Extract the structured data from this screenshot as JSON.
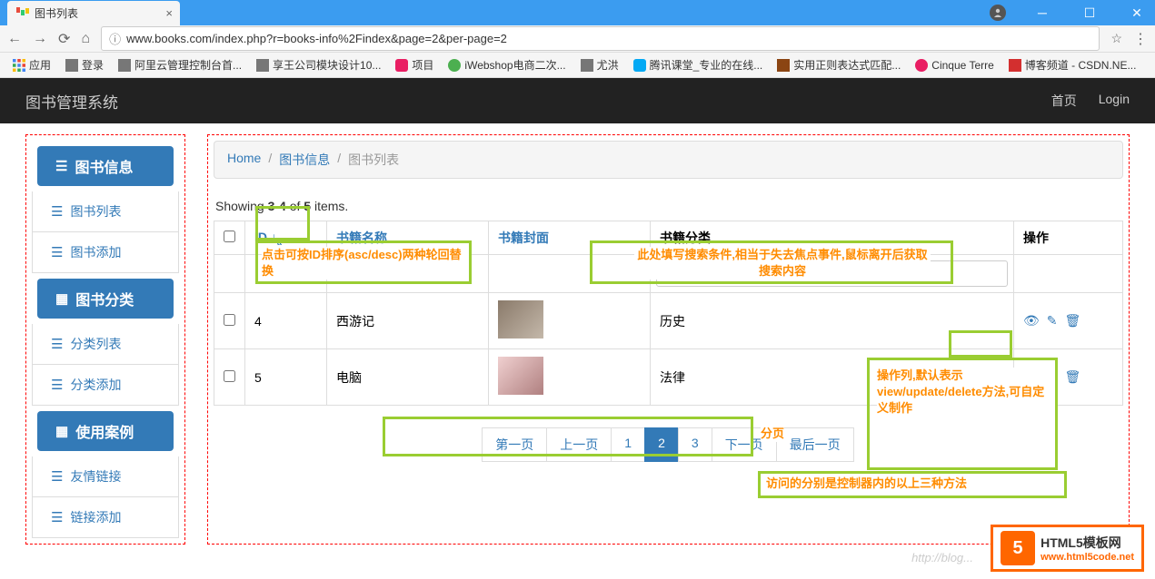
{
  "browser": {
    "tab_title": "图书列表",
    "url": "www.books.com/index.php?r=books-info%2Findex&page=2&per-page=2"
  },
  "bookmarks": {
    "apps": "应用",
    "items": [
      "登录",
      "阿里云管理控制台首...",
      "享王公司模块设计10...",
      "项目",
      "iWebshop电商二次...",
      "尤洪",
      "腾讯课堂_专业的在线...",
      "实用正则表达式匹配...",
      "Cinque Terre",
      "博客频道 - CSDN.NE..."
    ]
  },
  "header": {
    "app_title": "图书管理系统",
    "nav": {
      "home": "首页",
      "login": "Login"
    }
  },
  "sidebar": {
    "book_info": "图书信息",
    "book_list": "图书列表",
    "book_add": "图书添加",
    "book_category": "图书分类",
    "category_list": "分类列表",
    "category_add": "分类添加",
    "use_case": "使用案例",
    "friend_link": "友情链接",
    "link_add": "链接添加"
  },
  "breadcrumb": {
    "home": "Home",
    "book_info": "图书信息",
    "book_list": "图书列表"
  },
  "summary": {
    "prefix": "Showing ",
    "range": "3-4",
    "middle": " of ",
    "total": "5",
    "suffix": " items."
  },
  "table": {
    "headers": {
      "id": "ID",
      "name": "书籍名称",
      "cover": "书籍封面",
      "category": "书籍分类",
      "action": "操作"
    },
    "rows": [
      {
        "id": "4",
        "name": "西游记",
        "category": "历史"
      },
      {
        "id": "5",
        "name": "电脑",
        "category": "法律"
      }
    ]
  },
  "pagination": {
    "first": "第一页",
    "prev": "上一页",
    "p1": "1",
    "p2": "2",
    "p3": "3",
    "next": "下一页",
    "last": "最后一页"
  },
  "annotations": {
    "id_sort": "点击可按ID排序(asc/desc)两种轮回替换",
    "search": "此处填写搜索条件,相当于失去焦点事件,鼠标离开后获取搜索内容",
    "action": "操作列,默认表示view/update/delete方法,可自定义制作",
    "methods": "访问的分别是控制器内的以上三种方法",
    "paging": "分页"
  },
  "watermark": {
    "badge": "5",
    "title": "HTML5模板网",
    "url": "www.html5code.net"
  },
  "blog_url": "http://blog..."
}
